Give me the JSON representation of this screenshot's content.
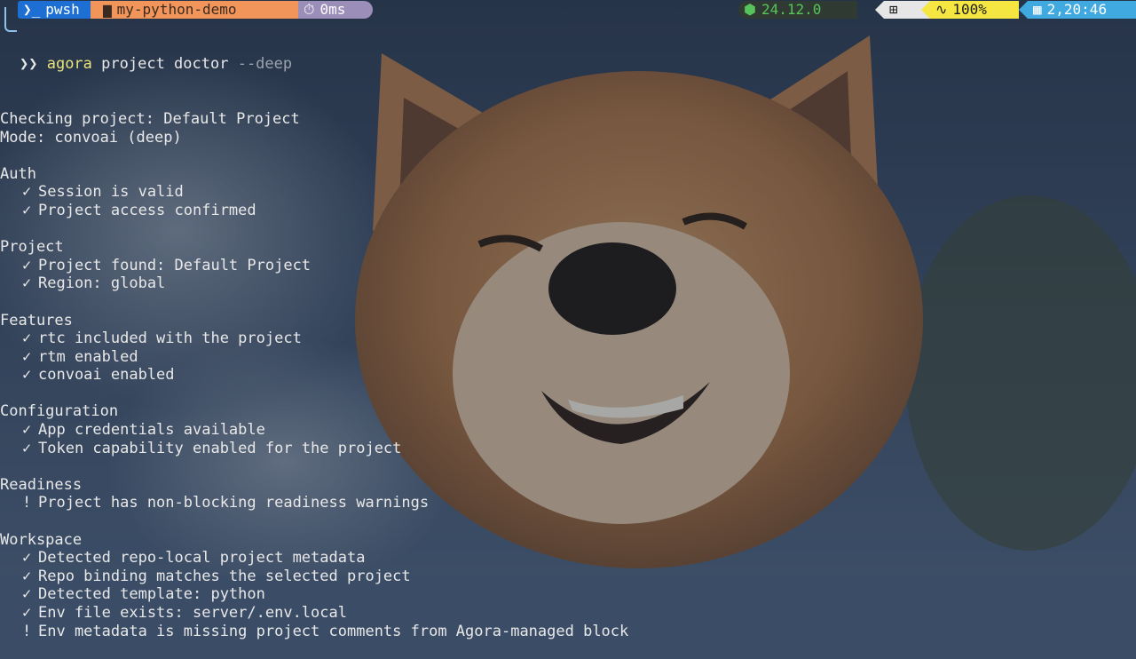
{
  "prompt": {
    "shell": "pwsh",
    "shell_icon": "terminal-prompt-icon",
    "path": "my-python-demo",
    "path_icon": "folder-icon",
    "exec_time": "0ms",
    "exec_icon": "stopwatch-icon",
    "node_version": "24.12.0",
    "node_icon": "nodejs-icon",
    "os_icon": "windows-icon",
    "battery": "100%",
    "battery_icon": "heartbeat-icon",
    "clock": "2,20:46",
    "clock_icon": "calendar-icon",
    "colors": {
      "shell": "#1d6fd3",
      "path": "#f2955a",
      "time": "#9b8fb9",
      "node": "#2f3a33",
      "battery": "#f5e642",
      "clock": "#3fa9e0"
    }
  },
  "command": {
    "name": "agora",
    "args": "project doctor",
    "flag": "--deep"
  },
  "output": {
    "header": [
      "Checking project: Default Project",
      "Mode: convoai (deep)"
    ],
    "sections": [
      {
        "title": "Auth",
        "items": [
          {
            "mark": "✓",
            "text": "Session is valid"
          },
          {
            "mark": "✓",
            "text": "Project access confirmed"
          }
        ]
      },
      {
        "title": "Project",
        "items": [
          {
            "mark": "✓",
            "text": "Project found: Default Project"
          },
          {
            "mark": "✓",
            "text": "Region: global"
          }
        ]
      },
      {
        "title": "Features",
        "items": [
          {
            "mark": "✓",
            "text": "rtc included with the project"
          },
          {
            "mark": "✓",
            "text": "rtm enabled"
          },
          {
            "mark": "✓",
            "text": "convoai enabled"
          }
        ]
      },
      {
        "title": "Configuration",
        "items": [
          {
            "mark": "✓",
            "text": "App credentials available"
          },
          {
            "mark": "✓",
            "text": "Token capability enabled for the project"
          }
        ]
      },
      {
        "title": "Readiness",
        "items": [
          {
            "mark": "!",
            "text": "Project has non-blocking readiness warnings"
          }
        ]
      },
      {
        "title": "Workspace",
        "items": [
          {
            "mark": "✓",
            "text": "Detected repo-local project metadata"
          },
          {
            "mark": "✓",
            "text": "Repo binding matches the selected project"
          },
          {
            "mark": "✓",
            "text": "Detected template: python"
          },
          {
            "mark": "✓",
            "text": "Env file exists: server/.env.local"
          },
          {
            "mark": "!",
            "text": "Env metadata is missing project comments from Agora-managed block"
          }
        ]
      }
    ]
  }
}
